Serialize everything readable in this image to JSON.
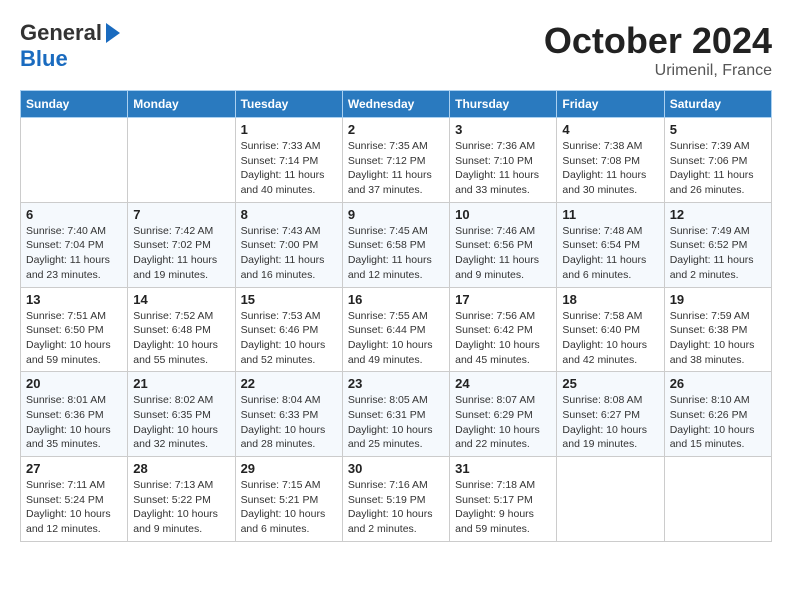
{
  "header": {
    "logo_general": "General",
    "logo_blue": "Blue",
    "month": "October 2024",
    "location": "Urimenil, France"
  },
  "days_of_week": [
    "Sunday",
    "Monday",
    "Tuesday",
    "Wednesday",
    "Thursday",
    "Friday",
    "Saturday"
  ],
  "weeks": [
    {
      "days": [
        {
          "num": "",
          "sunrise": "",
          "sunset": "",
          "daylight": ""
        },
        {
          "num": "",
          "sunrise": "",
          "sunset": "",
          "daylight": ""
        },
        {
          "num": "1",
          "sunrise": "Sunrise: 7:33 AM",
          "sunset": "Sunset: 7:14 PM",
          "daylight": "Daylight: 11 hours and 40 minutes."
        },
        {
          "num": "2",
          "sunrise": "Sunrise: 7:35 AM",
          "sunset": "Sunset: 7:12 PM",
          "daylight": "Daylight: 11 hours and 37 minutes."
        },
        {
          "num": "3",
          "sunrise": "Sunrise: 7:36 AM",
          "sunset": "Sunset: 7:10 PM",
          "daylight": "Daylight: 11 hours and 33 minutes."
        },
        {
          "num": "4",
          "sunrise": "Sunrise: 7:38 AM",
          "sunset": "Sunset: 7:08 PM",
          "daylight": "Daylight: 11 hours and 30 minutes."
        },
        {
          "num": "5",
          "sunrise": "Sunrise: 7:39 AM",
          "sunset": "Sunset: 7:06 PM",
          "daylight": "Daylight: 11 hours and 26 minutes."
        }
      ]
    },
    {
      "days": [
        {
          "num": "6",
          "sunrise": "Sunrise: 7:40 AM",
          "sunset": "Sunset: 7:04 PM",
          "daylight": "Daylight: 11 hours and 23 minutes."
        },
        {
          "num": "7",
          "sunrise": "Sunrise: 7:42 AM",
          "sunset": "Sunset: 7:02 PM",
          "daylight": "Daylight: 11 hours and 19 minutes."
        },
        {
          "num": "8",
          "sunrise": "Sunrise: 7:43 AM",
          "sunset": "Sunset: 7:00 PM",
          "daylight": "Daylight: 11 hours and 16 minutes."
        },
        {
          "num": "9",
          "sunrise": "Sunrise: 7:45 AM",
          "sunset": "Sunset: 6:58 PM",
          "daylight": "Daylight: 11 hours and 12 minutes."
        },
        {
          "num": "10",
          "sunrise": "Sunrise: 7:46 AM",
          "sunset": "Sunset: 6:56 PM",
          "daylight": "Daylight: 11 hours and 9 minutes."
        },
        {
          "num": "11",
          "sunrise": "Sunrise: 7:48 AM",
          "sunset": "Sunset: 6:54 PM",
          "daylight": "Daylight: 11 hours and 6 minutes."
        },
        {
          "num": "12",
          "sunrise": "Sunrise: 7:49 AM",
          "sunset": "Sunset: 6:52 PM",
          "daylight": "Daylight: 11 hours and 2 minutes."
        }
      ]
    },
    {
      "days": [
        {
          "num": "13",
          "sunrise": "Sunrise: 7:51 AM",
          "sunset": "Sunset: 6:50 PM",
          "daylight": "Daylight: 10 hours and 59 minutes."
        },
        {
          "num": "14",
          "sunrise": "Sunrise: 7:52 AM",
          "sunset": "Sunset: 6:48 PM",
          "daylight": "Daylight: 10 hours and 55 minutes."
        },
        {
          "num": "15",
          "sunrise": "Sunrise: 7:53 AM",
          "sunset": "Sunset: 6:46 PM",
          "daylight": "Daylight: 10 hours and 52 minutes."
        },
        {
          "num": "16",
          "sunrise": "Sunrise: 7:55 AM",
          "sunset": "Sunset: 6:44 PM",
          "daylight": "Daylight: 10 hours and 49 minutes."
        },
        {
          "num": "17",
          "sunrise": "Sunrise: 7:56 AM",
          "sunset": "Sunset: 6:42 PM",
          "daylight": "Daylight: 10 hours and 45 minutes."
        },
        {
          "num": "18",
          "sunrise": "Sunrise: 7:58 AM",
          "sunset": "Sunset: 6:40 PM",
          "daylight": "Daylight: 10 hours and 42 minutes."
        },
        {
          "num": "19",
          "sunrise": "Sunrise: 7:59 AM",
          "sunset": "Sunset: 6:38 PM",
          "daylight": "Daylight: 10 hours and 38 minutes."
        }
      ]
    },
    {
      "days": [
        {
          "num": "20",
          "sunrise": "Sunrise: 8:01 AM",
          "sunset": "Sunset: 6:36 PM",
          "daylight": "Daylight: 10 hours and 35 minutes."
        },
        {
          "num": "21",
          "sunrise": "Sunrise: 8:02 AM",
          "sunset": "Sunset: 6:35 PM",
          "daylight": "Daylight: 10 hours and 32 minutes."
        },
        {
          "num": "22",
          "sunrise": "Sunrise: 8:04 AM",
          "sunset": "Sunset: 6:33 PM",
          "daylight": "Daylight: 10 hours and 28 minutes."
        },
        {
          "num": "23",
          "sunrise": "Sunrise: 8:05 AM",
          "sunset": "Sunset: 6:31 PM",
          "daylight": "Daylight: 10 hours and 25 minutes."
        },
        {
          "num": "24",
          "sunrise": "Sunrise: 8:07 AM",
          "sunset": "Sunset: 6:29 PM",
          "daylight": "Daylight: 10 hours and 22 minutes."
        },
        {
          "num": "25",
          "sunrise": "Sunrise: 8:08 AM",
          "sunset": "Sunset: 6:27 PM",
          "daylight": "Daylight: 10 hours and 19 minutes."
        },
        {
          "num": "26",
          "sunrise": "Sunrise: 8:10 AM",
          "sunset": "Sunset: 6:26 PM",
          "daylight": "Daylight: 10 hours and 15 minutes."
        }
      ]
    },
    {
      "days": [
        {
          "num": "27",
          "sunrise": "Sunrise: 7:11 AM",
          "sunset": "Sunset: 5:24 PM",
          "daylight": "Daylight: 10 hours and 12 minutes."
        },
        {
          "num": "28",
          "sunrise": "Sunrise: 7:13 AM",
          "sunset": "Sunset: 5:22 PM",
          "daylight": "Daylight: 10 hours and 9 minutes."
        },
        {
          "num": "29",
          "sunrise": "Sunrise: 7:15 AM",
          "sunset": "Sunset: 5:21 PM",
          "daylight": "Daylight: 10 hours and 6 minutes."
        },
        {
          "num": "30",
          "sunrise": "Sunrise: 7:16 AM",
          "sunset": "Sunset: 5:19 PM",
          "daylight": "Daylight: 10 hours and 2 minutes."
        },
        {
          "num": "31",
          "sunrise": "Sunrise: 7:18 AM",
          "sunset": "Sunset: 5:17 PM",
          "daylight": "Daylight: 9 hours and 59 minutes."
        },
        {
          "num": "",
          "sunrise": "",
          "sunset": "",
          "daylight": ""
        },
        {
          "num": "",
          "sunrise": "",
          "sunset": "",
          "daylight": ""
        }
      ]
    }
  ]
}
